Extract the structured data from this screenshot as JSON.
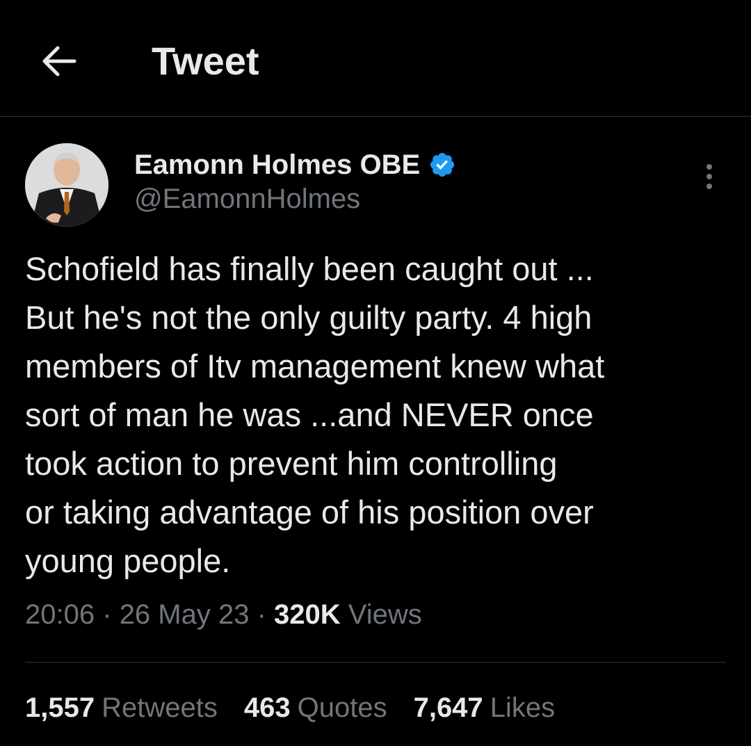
{
  "header": {
    "title": "Tweet",
    "back_icon": "arrow-left-icon"
  },
  "author": {
    "display_name": "Eamonn Holmes OBE",
    "handle": "@EamonnHolmes",
    "verified": true,
    "verified_color": "#1d9bf0"
  },
  "tweet": {
    "lines": [
      "Schofield has finally been caught out ...",
      "But he's not the only guilty party. 4 high",
      "members of Itv management knew what",
      "sort of man he was ...and NEVER once",
      "took action to prevent him controlling",
      "or taking advantage of his position over",
      "young people."
    ],
    "time": "20:06",
    "date": "26 May 23",
    "separator": "·",
    "views_count": "320K",
    "views_label": "Views"
  },
  "stats": {
    "retweets_count": "1,557",
    "retweets_label": "Retweets",
    "quotes_count": "463",
    "quotes_label": "Quotes",
    "likes_count": "7,647",
    "likes_label": "Likes"
  },
  "colors": {
    "background": "#000000",
    "text": "#e7e9ea",
    "secondary": "#71767b",
    "divider": "#2f3336"
  }
}
